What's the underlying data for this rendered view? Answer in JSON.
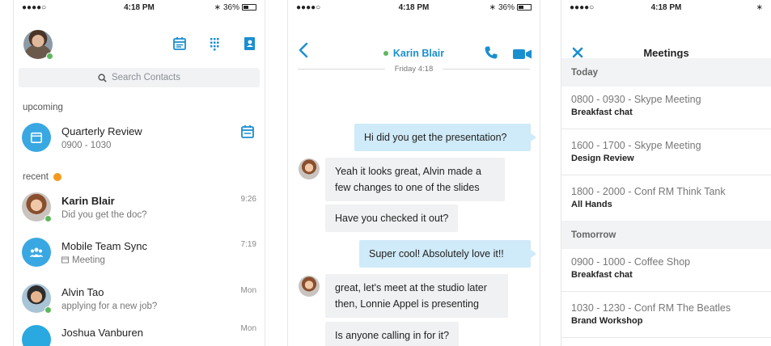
{
  "status": {
    "carrier": "●●●●○",
    "time": "4:18 PM",
    "battery": "36%"
  },
  "contacts": {
    "search_placeholder": "Search Contacts",
    "upcoming_label": "upcoming",
    "upcoming": {
      "title": "Quarterly Review",
      "time": "0900 - 1030"
    },
    "recent_label": "recent",
    "recent": [
      {
        "name": "Karin Blair",
        "message": "Did you get the doc?",
        "time": "9:26"
      },
      {
        "name": "Mobile Team Sync",
        "message": "Meeting",
        "time": "7:19"
      },
      {
        "name": "Alvin Tao",
        "message": "applying for a new job?",
        "time": "Mon"
      },
      {
        "name": "Joshua Vanburen",
        "message": "",
        "time": "Mon"
      }
    ]
  },
  "chat": {
    "contact_name": "Karin Blair",
    "day_divider": "Friday 4:18",
    "messages": [
      {
        "dir": "out",
        "text": "Hi did you get the presentation?"
      },
      {
        "dir": "in",
        "text": "Yeah it looks great, Alvin made a few changes to one of the slides"
      },
      {
        "dir": "in",
        "text": "Have you checked it out?"
      },
      {
        "dir": "out",
        "text": "Super cool! Absolutely love it!!"
      },
      {
        "dir": "in",
        "text": "great, let's meet at the studio later then, Lonnie Appel is presenting"
      },
      {
        "dir": "in",
        "text": "Is anyone calling in for it?"
      }
    ]
  },
  "meetings": {
    "title": "Meetings",
    "days": [
      {
        "label": "Today",
        "items": [
          {
            "time_loc": "0800 - 0930 - Skype Meeting",
            "name": "Breakfast chat"
          },
          {
            "time_loc": "1600 - 1700 - Skype Meeting",
            "name": "Design Review"
          },
          {
            "time_loc": "1800 - 2000 - Conf RM Think Tank",
            "name": "All Hands"
          }
        ]
      },
      {
        "label": "Tomorrow",
        "items": [
          {
            "time_loc": "0900 - 1000 - Coffee Shop",
            "name": "Breakfast chat"
          },
          {
            "time_loc": "1030 - 1230 - Conf RM The Beatles",
            "name": "Brand Workshop"
          }
        ]
      }
    ]
  },
  "colors": {
    "accent": "#1a8fd0",
    "presence": "#5cb85c",
    "recent_dot": "#f39a1e"
  }
}
